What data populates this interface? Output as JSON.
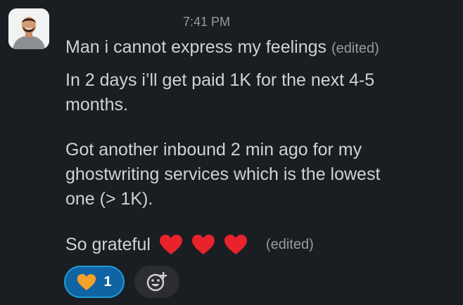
{
  "message": {
    "timestamp": "7:41 PM",
    "line1": "Man i cannot express my feelings",
    "line1_edited": "(edited)",
    "line2": "In 2 days i’ll get paid 1K for the next 4-5",
    "line3": "months.",
    "line4": "Got another inbound 2 min ago for my",
    "line5": "ghostwriting services which is the lowest",
    "line6": "one (> 1K).",
    "line7": "So grateful",
    "line7_edited": "(edited)",
    "hearts_icon": "red-heart-icon"
  },
  "reactions": {
    "orange_heart": {
      "icon": "orange-heart-icon",
      "count": "1"
    },
    "add_reaction_icon": "add-reaction-icon"
  },
  "colors": {
    "background": "#1a1d21",
    "text": "#d1d2d3",
    "muted": "#9a9b9d",
    "reaction_bg": "#1164a3",
    "reaction_border": "#1d9bd1",
    "heart_red": "#e8232b",
    "heart_orange": "#f6a12a"
  }
}
